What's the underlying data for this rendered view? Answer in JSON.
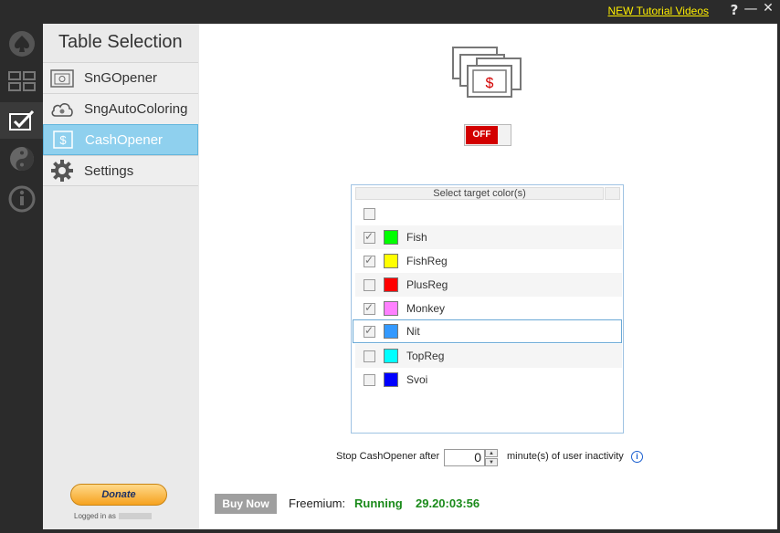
{
  "titlebar": {
    "tutorial_link": "NEW Tutorial Videos",
    "help": "?",
    "minimize": "—",
    "close": "✕"
  },
  "rail": {
    "icons": [
      "spade-icon",
      "grid-icon",
      "checkbox-icon",
      "yinyang-icon",
      "info-icon"
    ],
    "active_index": 2
  },
  "nav": {
    "title": "Table Selection",
    "items": [
      {
        "label": "SnGOpener",
        "icon": "sng-opener-icon"
      },
      {
        "label": "SngAutoColoring",
        "icon": "cloud-icon"
      },
      {
        "label": "CashOpener",
        "icon": "dollar-icon"
      },
      {
        "label": "Settings",
        "icon": "gear-icon"
      }
    ],
    "selected_index": 2,
    "donate_label": "Donate",
    "logged_in_label": "Logged in as"
  },
  "main": {
    "toggle_label": "OFF",
    "toggle_state": "off",
    "color_list": {
      "header": "Select target color(s)",
      "rows": [
        {
          "name": "",
          "checked": false,
          "color": ""
        },
        {
          "name": "Fish",
          "checked": true,
          "color": "#00ff00"
        },
        {
          "name": "FishReg",
          "checked": true,
          "color": "#ffff00"
        },
        {
          "name": "PlusReg",
          "checked": false,
          "color": "#ff0000"
        },
        {
          "name": "Monkey",
          "checked": true,
          "color": "#ff80ff"
        },
        {
          "name": "Nit",
          "checked": true,
          "color": "#3399ff"
        },
        {
          "name": "TopReg",
          "checked": false,
          "color": "#00ffff"
        },
        {
          "name": "Svoi",
          "checked": false,
          "color": "#0000ff"
        }
      ]
    },
    "inactivity": {
      "prefix": "Stop CashOpener after",
      "value": "0",
      "suffix": "minute(s) of user inactivity"
    },
    "footer": {
      "buy_label": "Buy Now",
      "plan_label": "Freemium:",
      "status": "Running",
      "timer": "29.20:03:56"
    }
  },
  "colors": {
    "accent_selected": "#8fd0ee",
    "toggle_off": "#d30000",
    "running_green": "#1a8a1a",
    "link_yellow": "#ffef00"
  }
}
